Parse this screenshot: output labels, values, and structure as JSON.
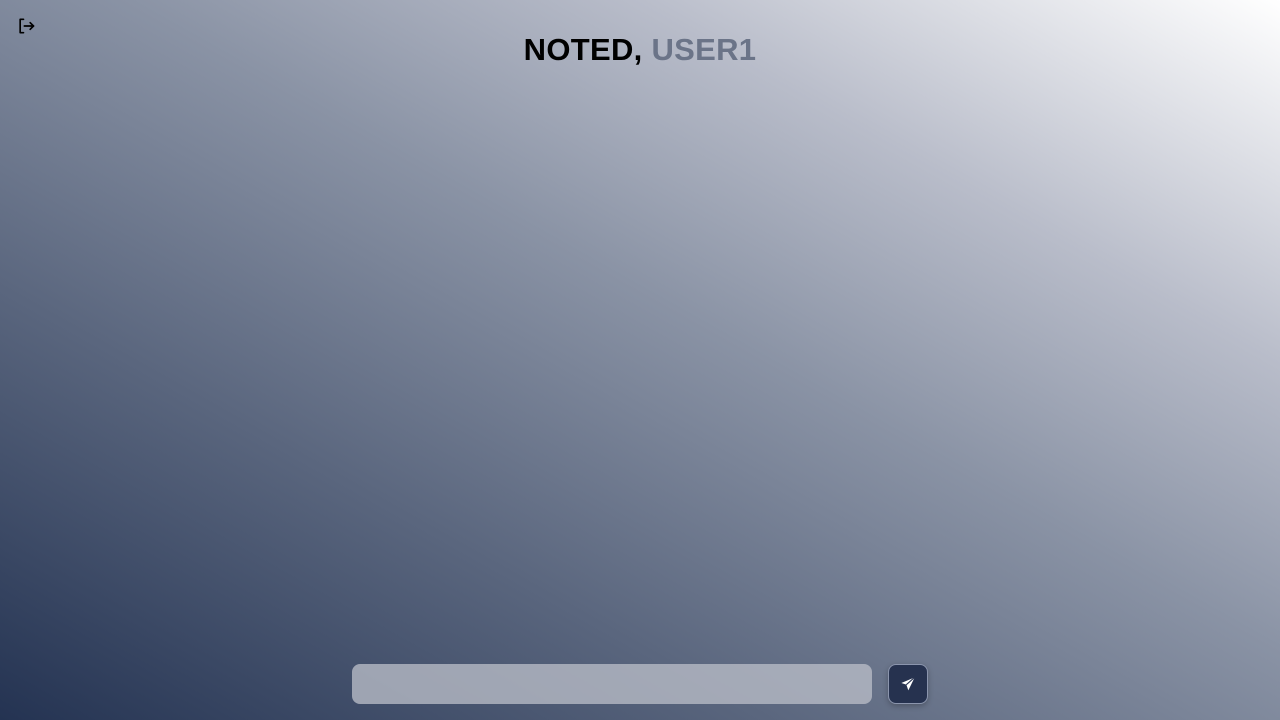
{
  "header": {
    "brand": "NOTED,",
    "username": "USER1",
    "logout_icon": "logout-icon"
  },
  "composer": {
    "input_value": "",
    "input_placeholder": "",
    "send_icon": "paper-plane-icon"
  },
  "colors": {
    "username_accent": "#6b7488",
    "send_button_bg": "#26324f",
    "gradient_dark": "#243352",
    "gradient_light": "#ffffff"
  }
}
